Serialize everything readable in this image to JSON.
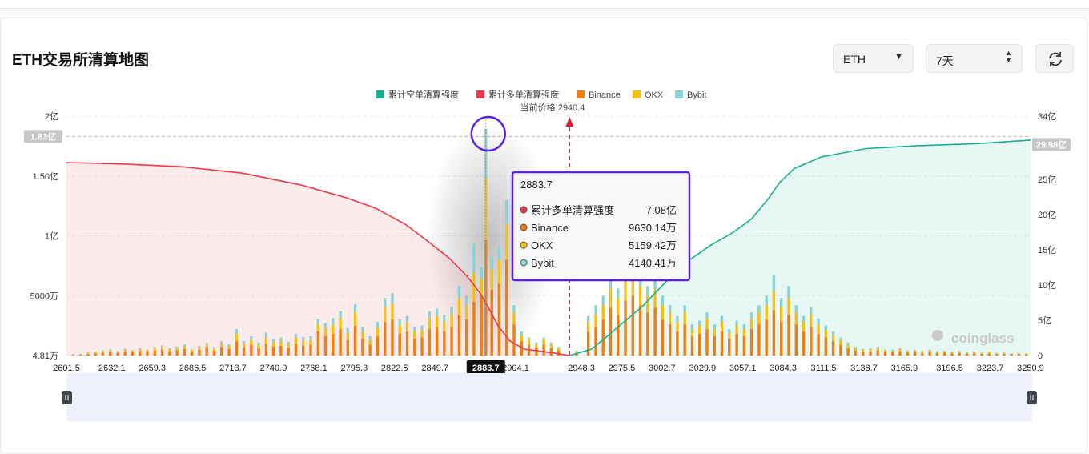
{
  "page": {
    "title": "ETH交易所清算地图",
    "exchange_select": {
      "value": "ETH"
    },
    "period_select": {
      "value": "7天"
    },
    "refresh_icon": "refresh-icon",
    "watermark": "coinglass"
  },
  "colors": {
    "short_cum": "#16b092",
    "long_cum": "#ef3848",
    "binance": "#f07d10",
    "okx": "#f5c012",
    "bybit": "#89d3d6",
    "highlight": "#5a1fe0"
  },
  "chart_data": {
    "type": "bar",
    "legend": [
      "累计空单清算强度",
      "累计多单清算强度",
      "Binance",
      "OKX",
      "Bybit"
    ],
    "legend_placement": "top-center",
    "current_price_label": "当前价格:2940.4",
    "current_price": 2940.4,
    "x_range": [
      2601.5,
      3250.9
    ],
    "x_ticks": [
      "2601.5",
      "2632.1",
      "2659.3",
      "2686.5",
      "2713.7",
      "2740.9",
      "2768.1",
      "2795.3",
      "2822.5",
      "2849.7",
      "2883.7",
      "2904.1",
      "2948.3",
      "2975.5",
      "3002.7",
      "3029.9",
      "3057.1",
      "3084.3",
      "3111.5",
      "3138.7",
      "3165.9",
      "3196.5",
      "3223.7",
      "3250.9"
    ],
    "x_tick_values": [
      2601.5,
      2632.1,
      2659.3,
      2686.5,
      2713.7,
      2740.9,
      2768.1,
      2795.3,
      2822.5,
      2849.7,
      2883.7,
      2904.1,
      2948.3,
      2975.5,
      3002.7,
      3029.9,
      3057.1,
      3084.3,
      3111.5,
      3138.7,
      3165.9,
      3196.5,
      3223.7,
      3250.9
    ],
    "y_left_ticks": [
      "4.81万",
      "5000万",
      "1亿",
      "1.50亿",
      "2亿"
    ],
    "y_left_tick_values": [
      0.000481,
      0.5,
      1.0,
      1.5,
      2.0
    ],
    "y_left_range": [
      0,
      2.0
    ],
    "y_left_unit": "亿",
    "y_left_highlight_label": "1.83亿",
    "y_left_highlight": 1.83,
    "y_right_ticks": [
      "0",
      "5亿",
      "10亿",
      "15亿",
      "20亿",
      "25亿",
      "30亿",
      "34亿"
    ],
    "y_right_tick_values": [
      0,
      5,
      10,
      15,
      20,
      25,
      30,
      34
    ],
    "y_right_range": [
      0,
      34
    ],
    "y_right_unit": "亿",
    "y_right_highlight_label": "29.98亿",
    "y_right_highlight": 29.98,
    "cum_long": {
      "name": "累计多单清算强度",
      "points": [
        [
          2601.5,
          27.4
        ],
        [
          2640,
          27.2
        ],
        [
          2680,
          26.8
        ],
        [
          2720,
          25.9
        ],
        [
          2760,
          24.2
        ],
        [
          2790,
          22.4
        ],
        [
          2810,
          20.9
        ],
        [
          2830,
          18.6
        ],
        [
          2845,
          16.2
        ],
        [
          2860,
          13.7
        ],
        [
          2872,
          11.1
        ],
        [
          2880,
          8.9
        ],
        [
          2886,
          6.7
        ],
        [
          2892,
          4.3
        ],
        [
          2900,
          2.1
        ],
        [
          2910,
          0.9
        ],
        [
          2930,
          0.35
        ],
        [
          2940.4,
          0
        ]
      ]
    },
    "cum_short": {
      "name": "累计空单清算强度",
      "points": [
        [
          2940.4,
          0
        ],
        [
          2955,
          0.9
        ],
        [
          2965,
          2.6
        ],
        [
          2975,
          4.4
        ],
        [
          2990,
          7.1
        ],
        [
          3005,
          10.4
        ],
        [
          3020,
          13.4
        ],
        [
          3035,
          15.6
        ],
        [
          3050,
          17.4
        ],
        [
          3063,
          19.4
        ],
        [
          3074,
          22.2
        ],
        [
          3082,
          24.6
        ],
        [
          3092,
          26.6
        ],
        [
          3110,
          28.2
        ],
        [
          3140,
          29.4
        ],
        [
          3175,
          29.8
        ],
        [
          3215,
          30.1
        ],
        [
          3250.9,
          30.6
        ]
      ]
    },
    "bars": {
      "series": [
        "Binance",
        "OKX",
        "Bybit"
      ],
      "note": "stacked per price level, values in 亿",
      "data": [
        [
          2606,
          0.004,
          0.004,
          0.004
        ],
        [
          2611,
          0.007,
          0.005,
          0.004
        ],
        [
          2616,
          0.012,
          0.008,
          0.005
        ],
        [
          2621,
          0.018,
          0.01,
          0.006
        ],
        [
          2626,
          0.024,
          0.012,
          0.008
        ],
        [
          2631,
          0.028,
          0.014,
          0.008
        ],
        [
          2636,
          0.02,
          0.01,
          0.006
        ],
        [
          2641,
          0.032,
          0.014,
          0.01
        ],
        [
          2646,
          0.026,
          0.012,
          0.008
        ],
        [
          2651,
          0.038,
          0.016,
          0.01
        ],
        [
          2656,
          0.03,
          0.012,
          0.008
        ],
        [
          2661,
          0.042,
          0.018,
          0.012
        ],
        [
          2666,
          0.05,
          0.02,
          0.014
        ],
        [
          2671,
          0.036,
          0.016,
          0.01
        ],
        [
          2676,
          0.045,
          0.018,
          0.012
        ],
        [
          2681,
          0.054,
          0.022,
          0.016
        ],
        [
          2686,
          0.03,
          0.014,
          0.01
        ],
        [
          2691,
          0.048,
          0.02,
          0.014
        ],
        [
          2696,
          0.064,
          0.026,
          0.016
        ],
        [
          2701,
          0.04,
          0.018,
          0.012
        ],
        [
          2706,
          0.07,
          0.028,
          0.02
        ],
        [
          2711,
          0.055,
          0.022,
          0.016
        ],
        [
          2716,
          0.12,
          0.06,
          0.04
        ],
        [
          2721,
          0.07,
          0.03,
          0.02
        ],
        [
          2726,
          0.09,
          0.04,
          0.03
        ],
        [
          2731,
          0.06,
          0.03,
          0.02
        ],
        [
          2736,
          0.1,
          0.05,
          0.04
        ],
        [
          2741,
          0.075,
          0.035,
          0.025
        ],
        [
          2746,
          0.08,
          0.04,
          0.03
        ],
        [
          2751,
          0.065,
          0.03,
          0.02
        ],
        [
          2756,
          0.1,
          0.05,
          0.03
        ],
        [
          2761,
          0.085,
          0.04,
          0.03
        ],
        [
          2766,
          0.09,
          0.04,
          0.03
        ],
        [
          2771,
          0.2,
          0.06,
          0.04
        ],
        [
          2776,
          0.16,
          0.07,
          0.04
        ],
        [
          2781,
          0.18,
          0.08,
          0.05
        ],
        [
          2786,
          0.22,
          0.09,
          0.06
        ],
        [
          2791,
          0.13,
          0.06,
          0.04
        ],
        [
          2796,
          0.25,
          0.11,
          0.07
        ],
        [
          2801,
          0.14,
          0.06,
          0.04
        ],
        [
          2806,
          0.09,
          0.04,
          0.03
        ],
        [
          2811,
          0.16,
          0.07,
          0.05
        ],
        [
          2816,
          0.28,
          0.12,
          0.08
        ],
        [
          2821,
          0.3,
          0.13,
          0.09
        ],
        [
          2826,
          0.18,
          0.07,
          0.05
        ],
        [
          2831,
          0.2,
          0.08,
          0.05
        ],
        [
          2836,
          0.14,
          0.06,
          0.04
        ],
        [
          2841,
          0.15,
          0.06,
          0.04
        ],
        [
          2846,
          0.22,
          0.09,
          0.06
        ],
        [
          2851,
          0.24,
          0.09,
          0.06
        ],
        [
          2856,
          0.2,
          0.08,
          0.06
        ],
        [
          2861,
          0.24,
          0.1,
          0.07
        ],
        [
          2866,
          0.34,
          0.14,
          0.1
        ],
        [
          2871,
          0.3,
          0.12,
          0.08
        ],
        [
          2876,
          0.45,
          0.24,
          0.24
        ],
        [
          2881,
          0.5,
          0.14,
          0.1
        ],
        [
          2884,
          0.963,
          0.516,
          0.414
        ],
        [
          2888,
          0.55,
          0.17,
          0.1
        ],
        [
          2893,
          0.6,
          0.2,
          0.1
        ],
        [
          2898,
          0.8,
          0.3,
          0.2
        ],
        [
          2903,
          0.26,
          0.1,
          0.06
        ],
        [
          2908,
          0.12,
          0.05,
          0.03
        ],
        [
          2913,
          0.09,
          0.04,
          0.02
        ],
        [
          2918,
          0.06,
          0.03,
          0.02
        ],
        [
          2923,
          0.09,
          0.04,
          0.02
        ],
        [
          2928,
          0.06,
          0.03,
          0.02
        ],
        [
          2933,
          0.04,
          0.02,
          0.01
        ],
        [
          2945,
          0.02,
          0.01,
          0.01
        ],
        [
          2953,
          0.2,
          0.08,
          0.05
        ],
        [
          2958,
          0.24,
          0.1,
          0.08
        ],
        [
          2963,
          0.3,
          0.12,
          0.08
        ],
        [
          2968,
          0.4,
          0.16,
          0.1
        ],
        [
          2973,
          0.34,
          0.14,
          0.08
        ],
        [
          2978,
          0.46,
          0.18,
          0.1
        ],
        [
          2983,
          0.5,
          0.2,
          0.12
        ],
        [
          2988,
          0.42,
          0.16,
          0.1
        ],
        [
          2993,
          0.36,
          0.14,
          0.08
        ],
        [
          2998,
          0.4,
          0.15,
          0.09
        ],
        [
          3003,
          0.3,
          0.12,
          0.08
        ],
        [
          3008,
          0.26,
          0.1,
          0.06
        ],
        [
          3013,
          0.2,
          0.08,
          0.05
        ],
        [
          3018,
          0.26,
          0.1,
          0.06
        ],
        [
          3023,
          0.16,
          0.06,
          0.04
        ],
        [
          3028,
          0.18,
          0.07,
          0.04
        ],
        [
          3033,
          0.22,
          0.09,
          0.05
        ],
        [
          3038,
          0.16,
          0.06,
          0.04
        ],
        [
          3043,
          0.2,
          0.08,
          0.05
        ],
        [
          3048,
          0.14,
          0.05,
          0.03
        ],
        [
          3053,
          0.18,
          0.07,
          0.04
        ],
        [
          3058,
          0.16,
          0.06,
          0.04
        ],
        [
          3063,
          0.22,
          0.09,
          0.05
        ],
        [
          3068,
          0.26,
          0.1,
          0.06
        ],
        [
          3073,
          0.3,
          0.12,
          0.08
        ],
        [
          3078,
          0.38,
          0.16,
          0.13
        ],
        [
          3083,
          0.28,
          0.12,
          0.08
        ],
        [
          3088,
          0.34,
          0.14,
          0.1
        ],
        [
          3093,
          0.26,
          0.1,
          0.06
        ],
        [
          3098,
          0.2,
          0.08,
          0.05
        ],
        [
          3103,
          0.24,
          0.1,
          0.06
        ],
        [
          3108,
          0.18,
          0.08,
          0.05
        ],
        [
          3113,
          0.15,
          0.06,
          0.04
        ],
        [
          3118,
          0.12,
          0.05,
          0.03
        ],
        [
          3123,
          0.09,
          0.04,
          0.02
        ],
        [
          3128,
          0.06,
          0.03,
          0.02
        ],
        [
          3133,
          0.04,
          0.02,
          0.01
        ],
        [
          3138,
          0.03,
          0.015,
          0.01
        ],
        [
          3143,
          0.035,
          0.015,
          0.01
        ],
        [
          3148,
          0.04,
          0.02,
          0.01
        ],
        [
          3153,
          0.03,
          0.012,
          0.008
        ],
        [
          3158,
          0.028,
          0.012,
          0.008
        ],
        [
          3163,
          0.035,
          0.015,
          0.01
        ],
        [
          3168,
          0.025,
          0.01,
          0.008
        ],
        [
          3173,
          0.03,
          0.012,
          0.008
        ],
        [
          3178,
          0.022,
          0.01,
          0.006
        ],
        [
          3183,
          0.028,
          0.012,
          0.008
        ],
        [
          3188,
          0.02,
          0.01,
          0.006
        ],
        [
          3193,
          0.025,
          0.01,
          0.006
        ],
        [
          3198,
          0.018,
          0.008,
          0.005
        ],
        [
          3203,
          0.022,
          0.01,
          0.006
        ],
        [
          3208,
          0.015,
          0.007,
          0.005
        ],
        [
          3213,
          0.02,
          0.008,
          0.005
        ],
        [
          3218,
          0.014,
          0.006,
          0.004
        ],
        [
          3223,
          0.018,
          0.008,
          0.005
        ],
        [
          3228,
          0.012,
          0.006,
          0.004
        ],
        [
          3233,
          0.015,
          0.007,
          0.004
        ],
        [
          3238,
          0.01,
          0.005,
          0.003
        ],
        [
          3243,
          0.012,
          0.006,
          0.004
        ],
        [
          3248,
          0.01,
          0.005,
          0.003
        ]
      ]
    },
    "hover": {
      "x_label": "2883.7",
      "title": "2883.7",
      "rows": [
        {
          "label": "累计多单清算强度",
          "value": "7.08亿",
          "color": "#ef3848"
        },
        {
          "label": "Binance",
          "value": "9630.14万",
          "color": "#f07d10"
        },
        {
          "label": "OKX",
          "value": "5159.42万",
          "color": "#f5c012"
        },
        {
          "label": "Bybit",
          "value": "4140.41万",
          "color": "#89d3d6"
        }
      ]
    }
  }
}
